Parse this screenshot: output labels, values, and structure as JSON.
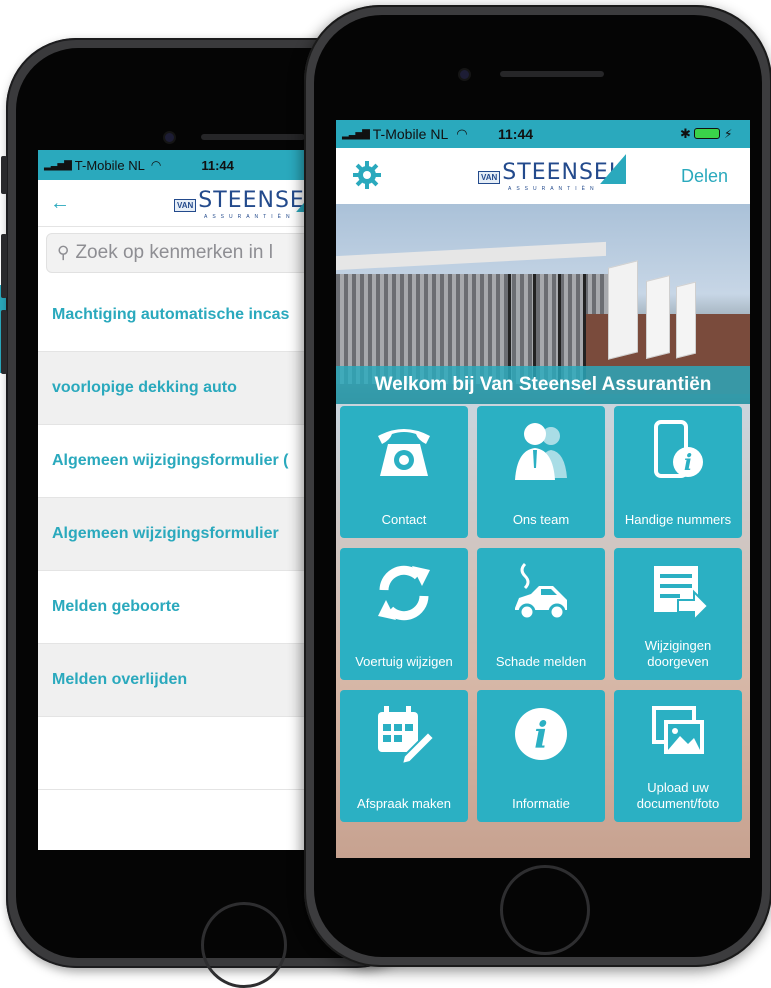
{
  "back_screen": {
    "status": {
      "carrier": "T-Mobile NL",
      "time": "11:44"
    },
    "nav": {
      "back_symbol": "←"
    },
    "logo": {
      "van": "VAN",
      "name": "STEENSEL",
      "sub": "ASSURANTIËN"
    },
    "search": {
      "placeholder": "Zoek op kenmerken in l"
    },
    "items": [
      {
        "label": "Machtiging automatische incas"
      },
      {
        "label": "voorlopige dekking auto"
      },
      {
        "label": "Algemeen wijzigingsformulier ("
      },
      {
        "label": "Algemeen wijzigingsformulier"
      },
      {
        "label": "Melden geboorte"
      },
      {
        "label": "Melden overlijden"
      }
    ]
  },
  "front_screen": {
    "status": {
      "carrier": "T-Mobile NL",
      "time": "11:44"
    },
    "nav": {
      "share_label": "Delen"
    },
    "logo": {
      "van": "VAN",
      "name": "STEENSEL",
      "sub": "ASSURANTIËN"
    },
    "banner": {
      "welcome": "Welkom bij Van Steensel Assurantiën"
    },
    "tiles": [
      {
        "label": "Contact",
        "icon": "phone-icon"
      },
      {
        "label": "Ons team",
        "icon": "team-icon"
      },
      {
        "label": "Handige nummers",
        "icon": "mobile-info-icon"
      },
      {
        "label": "Voertuig wijzigen",
        "icon": "refresh-icon"
      },
      {
        "label": "Schade melden",
        "icon": "car-damage-icon"
      },
      {
        "label": "Wijzigingen doorgeven",
        "icon": "document-forward-icon"
      },
      {
        "label": "Afspraak maken",
        "icon": "calendar-edit-icon"
      },
      {
        "label": "Informatie",
        "icon": "info-icon"
      },
      {
        "label": "Upload uw document/foto",
        "icon": "image-upload-icon"
      }
    ],
    "accent_color": "#2aa9bd"
  }
}
